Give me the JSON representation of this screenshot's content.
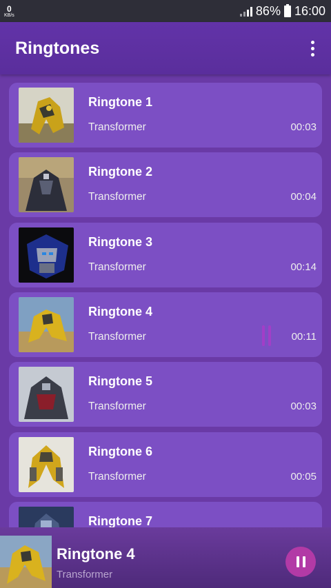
{
  "status_bar": {
    "net_speed": "0",
    "net_unit": "KB/s",
    "battery": "86%",
    "time": "16:00"
  },
  "app_bar": {
    "title": "Ringtones",
    "menu_icon": "more-vert-icon"
  },
  "ringtones": [
    {
      "title": "Ringtone 1",
      "subtitle": "Transformer",
      "duration": "00:03"
    },
    {
      "title": "Ringtone 2",
      "subtitle": "Transformer",
      "duration": "00:04"
    },
    {
      "title": "Ringtone 3",
      "subtitle": "Transformer",
      "duration": "00:14"
    },
    {
      "title": "Ringtone 4",
      "subtitle": "Transformer",
      "duration": "00:11",
      "playing": true
    },
    {
      "title": "Ringtone 5",
      "subtitle": "Transformer",
      "duration": "00:03"
    },
    {
      "title": "Ringtone 6",
      "subtitle": "Transformer",
      "duration": "00:05"
    },
    {
      "title": "Ringtone 7",
      "subtitle": "",
      "duration": ""
    }
  ],
  "now_playing": {
    "title": "Ringtone 4",
    "subtitle": "Transformer",
    "control_icon": "pause-icon"
  },
  "colors": {
    "background": "#6a3aa6",
    "card": "#7c4fc4",
    "app_bar": "#5f31a4",
    "accent": "#b23aa6"
  }
}
